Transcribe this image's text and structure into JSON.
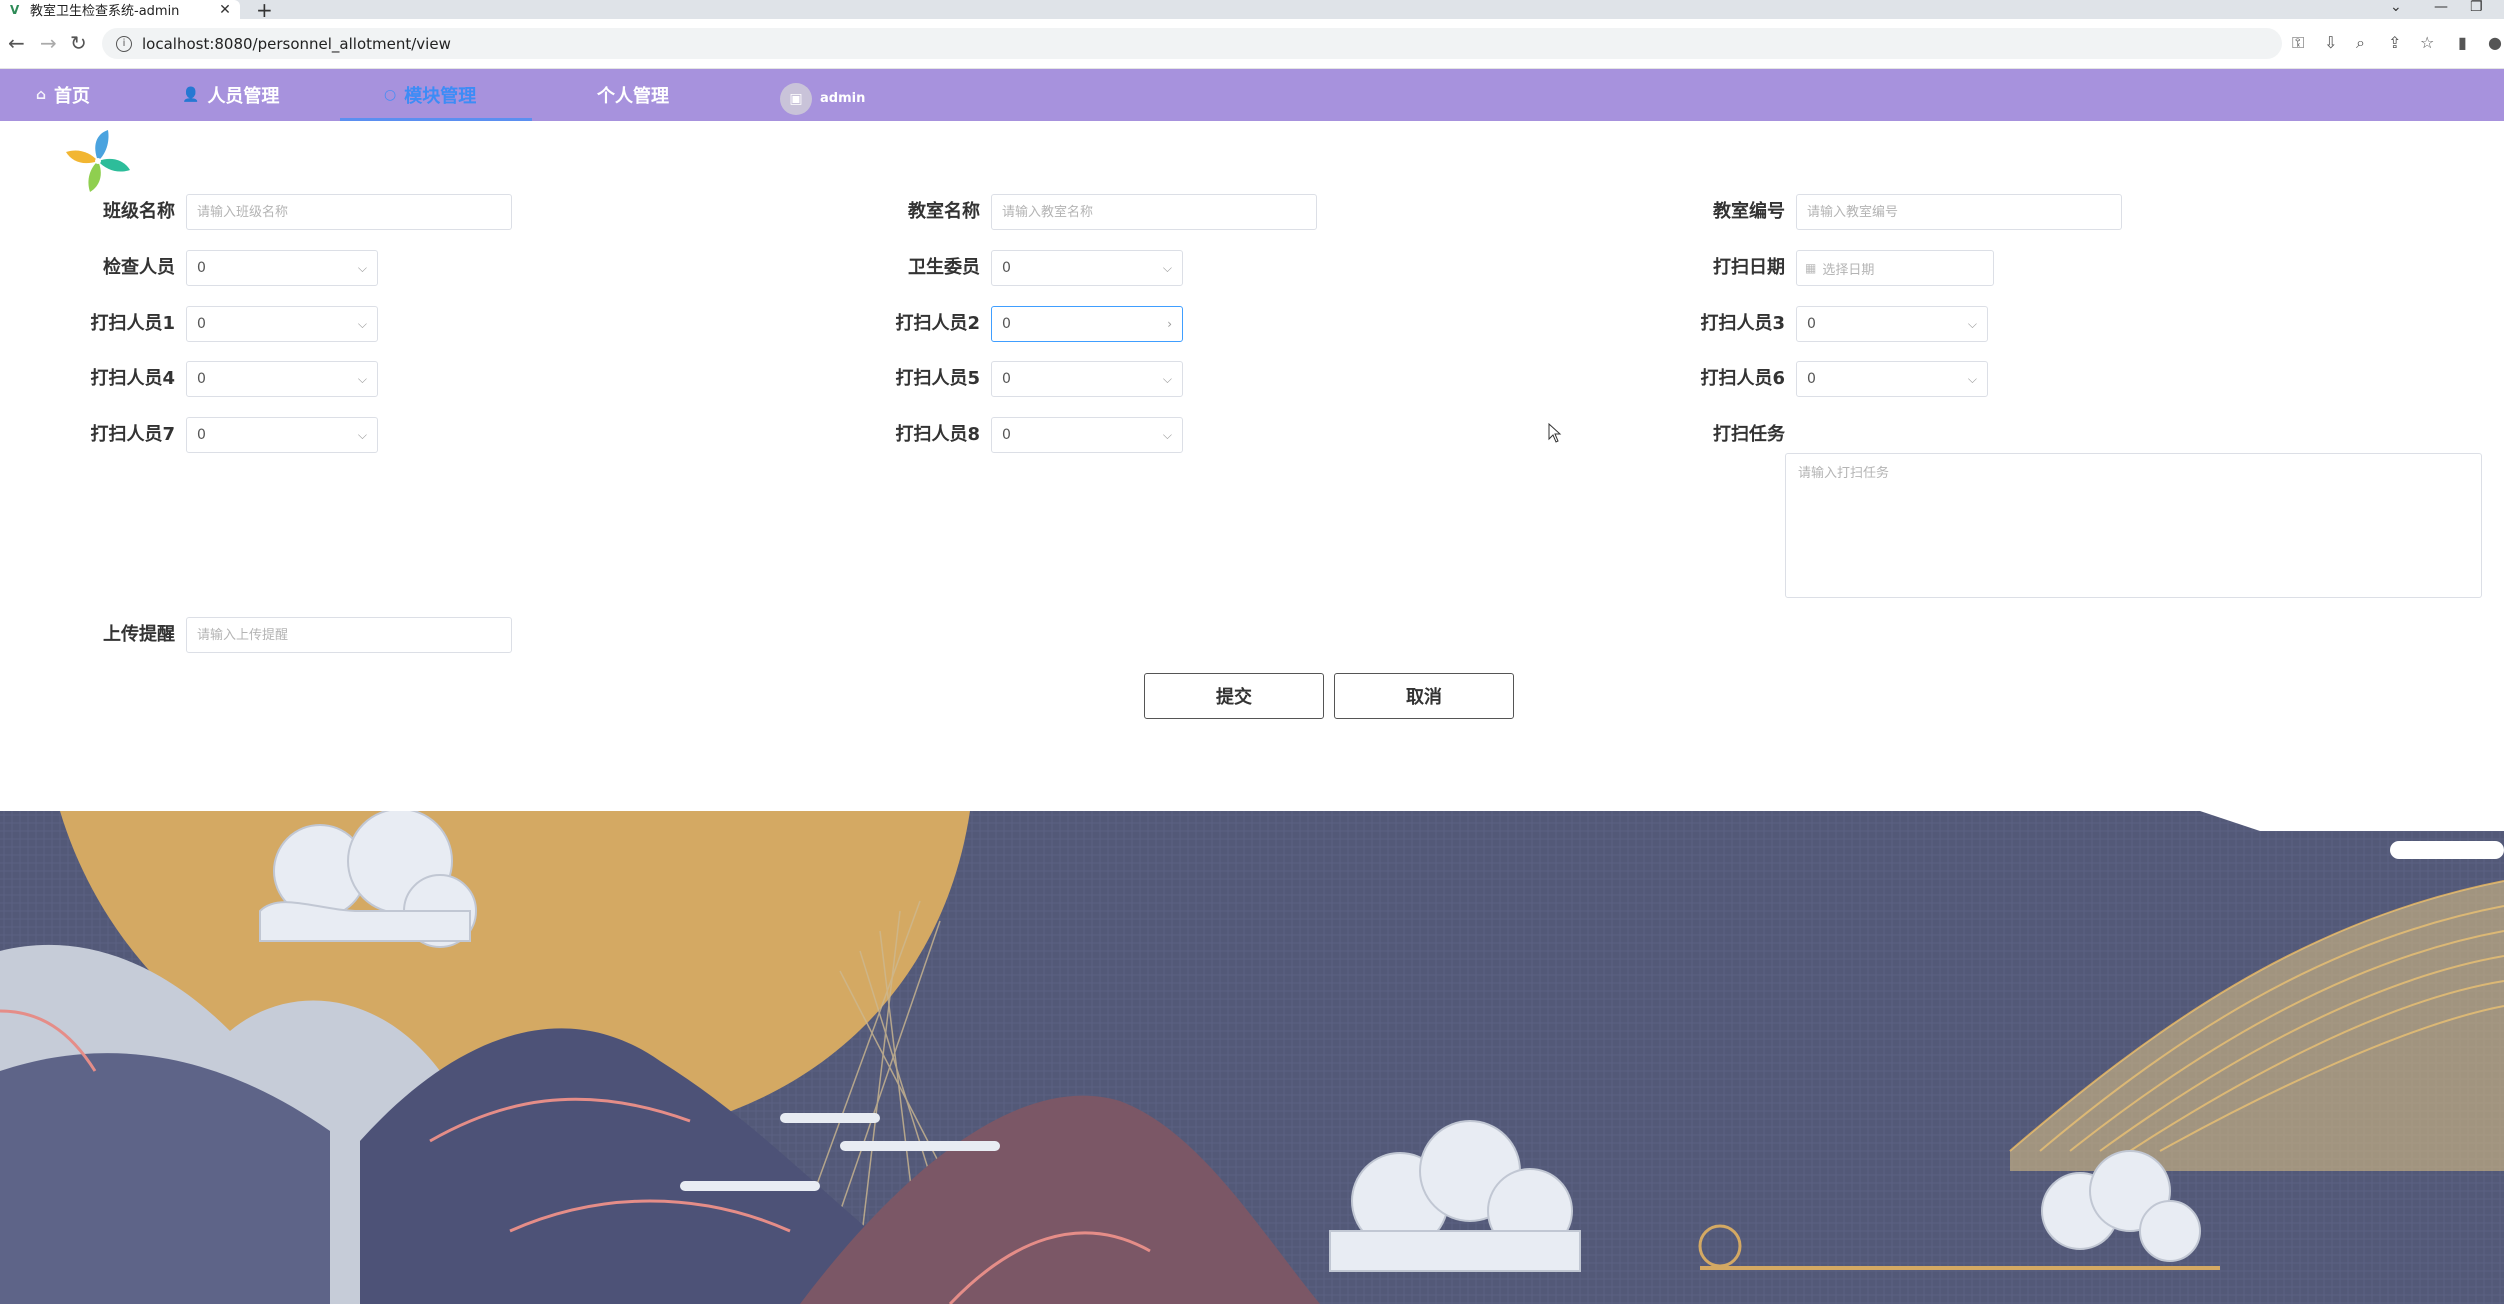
{
  "browser": {
    "tab_title": "教室卫生检查系统-admin",
    "url": "localhost:8080/personnel_allotment/view"
  },
  "nav": {
    "items": [
      {
        "label": "首页",
        "icon": "home-icon",
        "active": false
      },
      {
        "label": "人员管理",
        "icon": "user-icon",
        "active": false
      },
      {
        "label": "模块管理",
        "icon": "chat-icon",
        "active": true
      },
      {
        "label": "个人管理",
        "icon": "",
        "active": false
      }
    ],
    "username": "admin"
  },
  "form": {
    "class_name": {
      "label": "班级名称",
      "placeholder": "请输入班级名称"
    },
    "classroom_name": {
      "label": "教室名称",
      "placeholder": "请输入教室名称"
    },
    "classroom_number": {
      "label": "教室编号",
      "placeholder": "请输入教室编号"
    },
    "inspector": {
      "label": "检查人员",
      "value": "0"
    },
    "hygiene_committee": {
      "label": "卫生委员",
      "value": "0"
    },
    "cleaning_date": {
      "label": "打扫日期",
      "placeholder": "选择日期"
    },
    "cleaner1": {
      "label": "打扫人员1",
      "value": "0"
    },
    "cleaner2": {
      "label": "打扫人员2",
      "value": "0"
    },
    "cleaner3": {
      "label": "打扫人员3",
      "value": "0"
    },
    "cleaner4": {
      "label": "打扫人员4",
      "value": "0"
    },
    "cleaner5": {
      "label": "打扫人员5",
      "value": "0"
    },
    "cleaner6": {
      "label": "打扫人员6",
      "value": "0"
    },
    "cleaner7": {
      "label": "打扫人员7",
      "value": "0"
    },
    "cleaner8": {
      "label": "打扫人员8",
      "value": "0"
    },
    "cleaning_task": {
      "label": "打扫任务",
      "placeholder": "请输入打扫任务"
    },
    "upload_reminder": {
      "label": "上传提醒",
      "placeholder": "请输入上传提醒"
    },
    "submit_label": "提交",
    "cancel_label": "取消"
  },
  "colors": {
    "nav_bg": "#a792dd",
    "active_nav": "#3d8cf6",
    "sun": "#d4a963",
    "sky": "#535978"
  }
}
